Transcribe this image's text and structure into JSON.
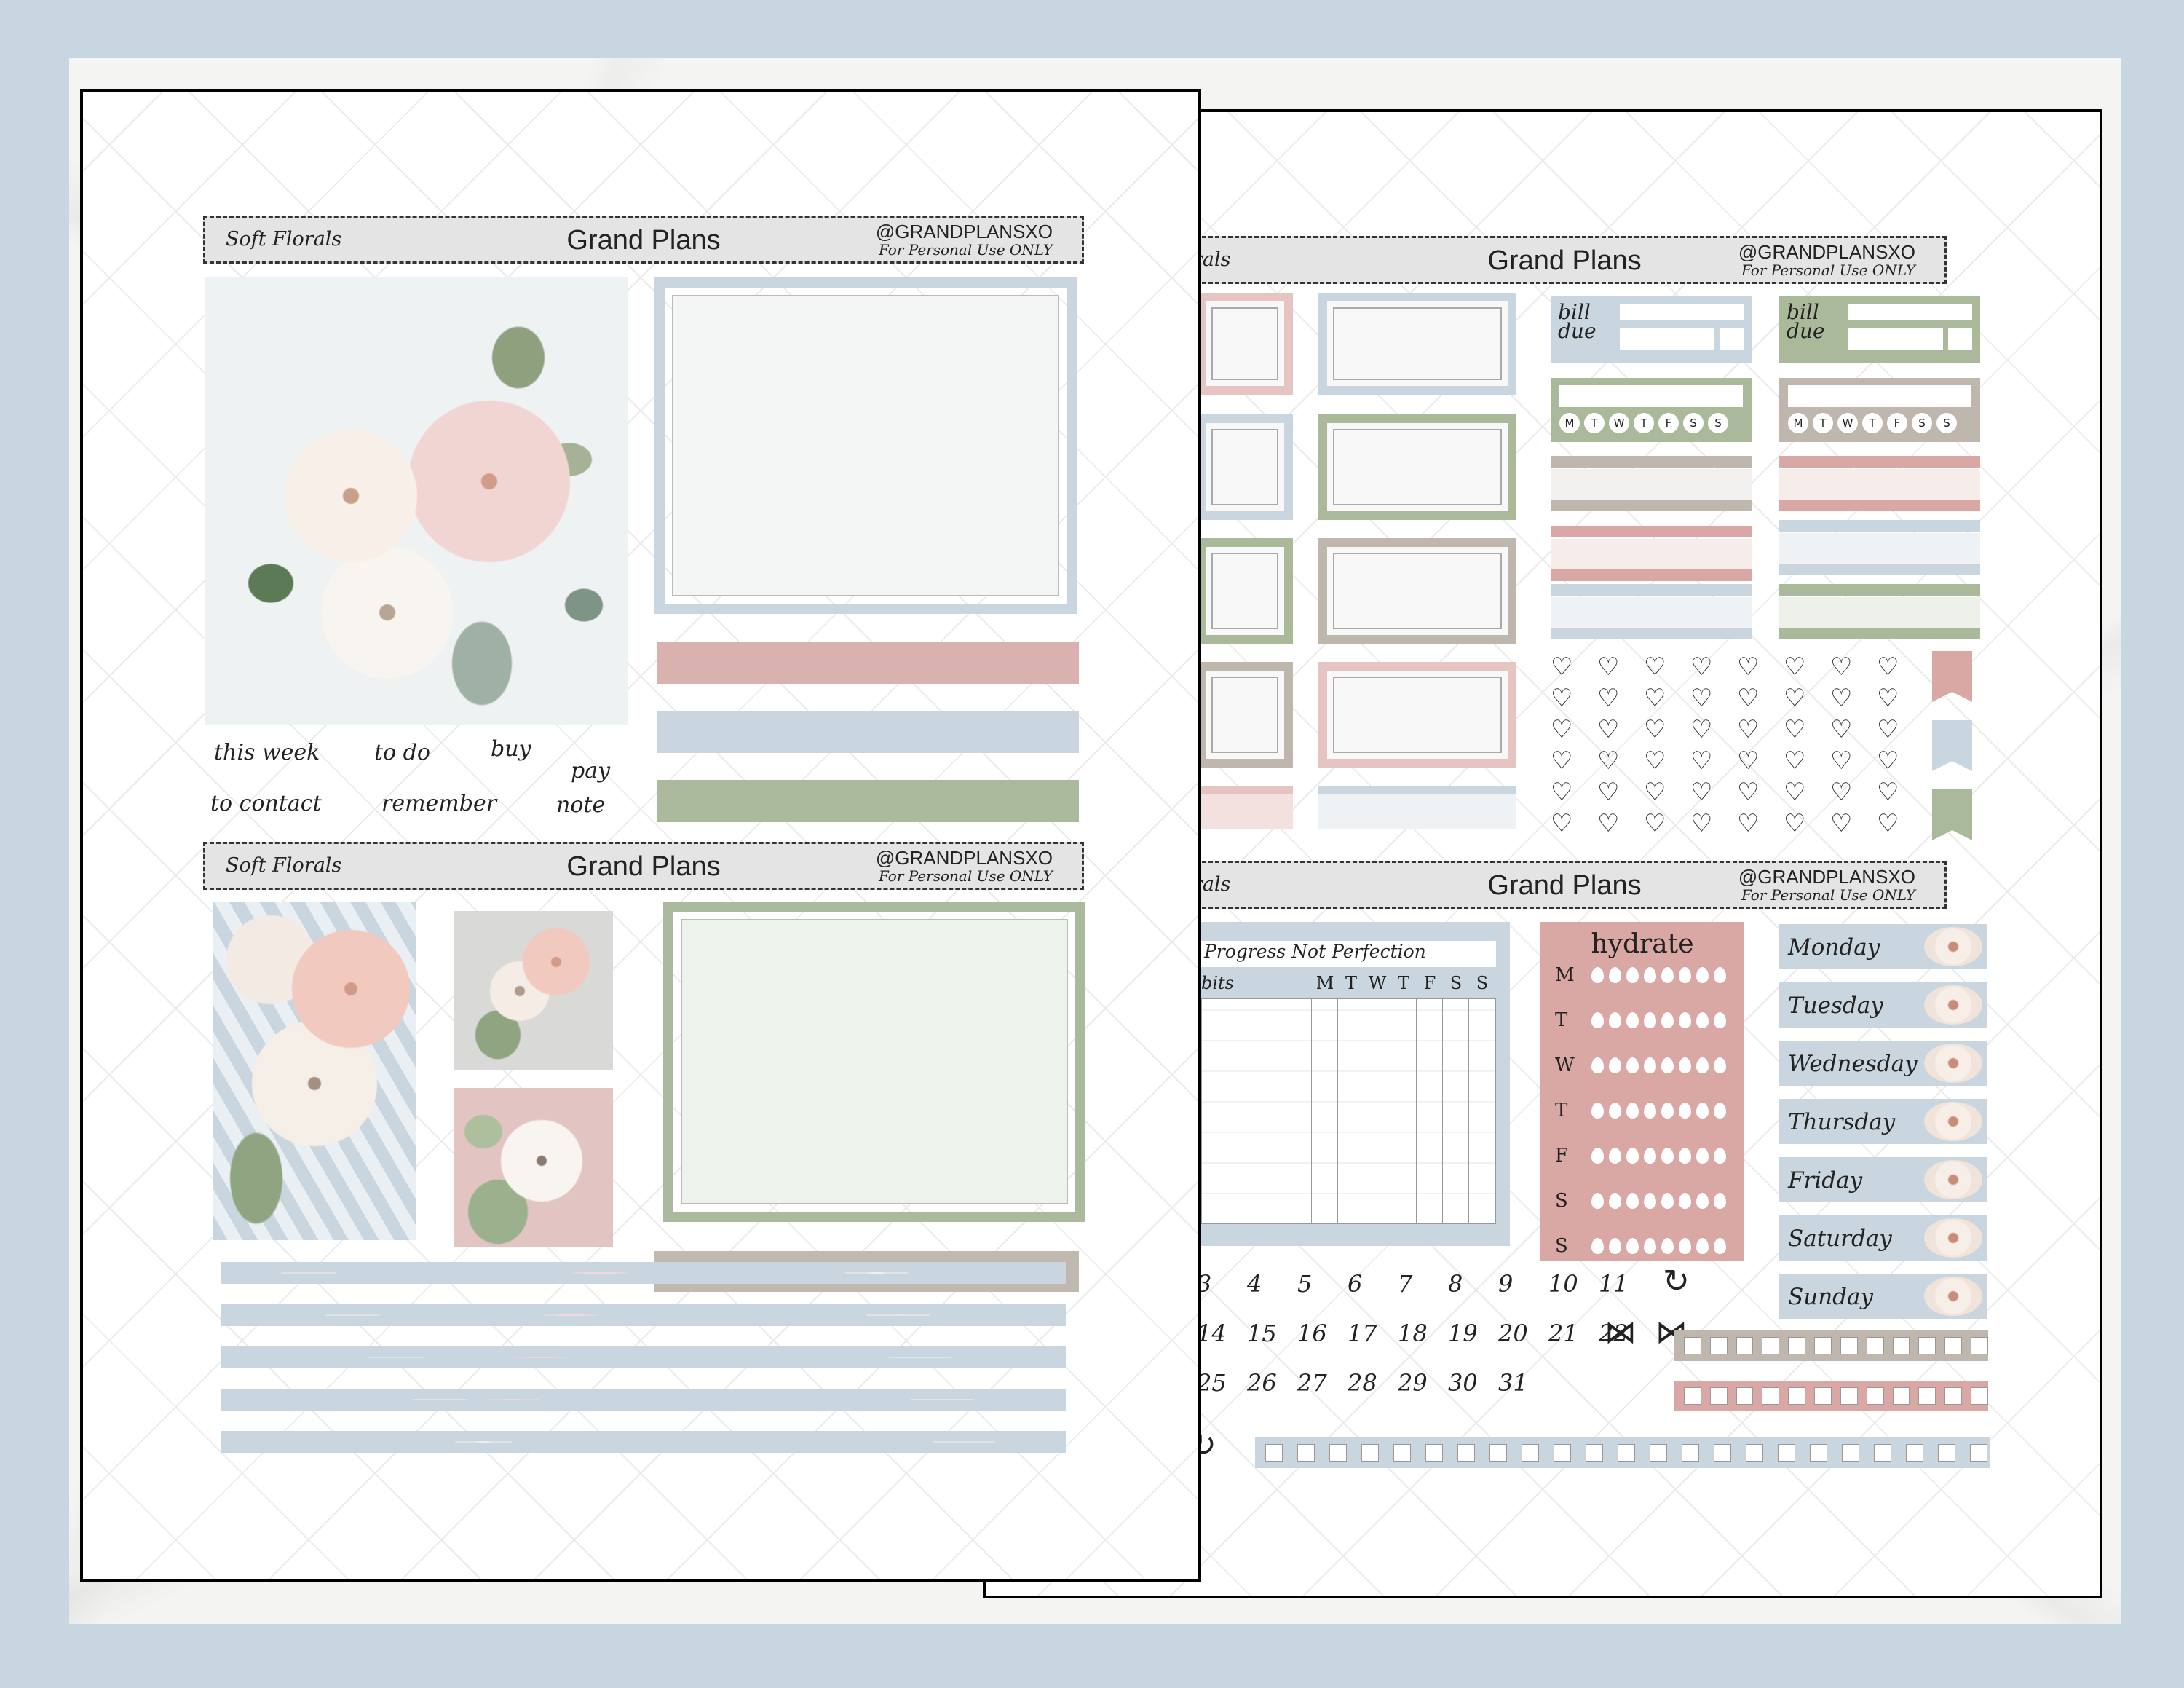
{
  "sheet1": {
    "header1": {
      "left": "Soft Florals",
      "center": "Grand Plans",
      "handle": "@GRANDPLANSXO",
      "note": "For Personal Use ONLY"
    },
    "header2": {
      "left": "Soft Florals",
      "center": "Grand Plans",
      "handle": "@GRANDPLANSXO",
      "note": "For Personal Use ONLY"
    },
    "script_labels": [
      "this week",
      "to do",
      "buy",
      "pay",
      "to contact",
      "remember",
      "note"
    ]
  },
  "sheet2": {
    "header1": {
      "left": "rals",
      "center": "Grand Plans",
      "handle": "@GRANDPLANSXO",
      "note": "For Personal Use ONLY"
    },
    "header2": {
      "left": "rals",
      "center": "Grand Plans",
      "handle": "@GRANDPLANSXO",
      "note": "For Personal Use ONLY"
    },
    "bill_label": "bill due",
    "weekdays_short": [
      "M",
      "T",
      "W",
      "T",
      "F",
      "S",
      "S"
    ],
    "habit": {
      "title": "Progress Not Perfection",
      "col_label": "bits",
      "days": [
        "M",
        "T",
        "W",
        "T",
        "F",
        "S",
        "S"
      ]
    },
    "hydrate": {
      "title": "hydrate",
      "days": [
        "M",
        "T",
        "W",
        "T",
        "F",
        "S",
        "S"
      ]
    },
    "days": [
      "Monday",
      "Tuesday",
      "Wednesday",
      "Thursday",
      "Friday",
      "Saturday",
      "Sunday"
    ],
    "dates_row1": [
      "3",
      "4",
      "5",
      "6",
      "7",
      "8",
      "9",
      "10",
      "11"
    ],
    "dates_row2": [
      "14",
      "15",
      "16",
      "17",
      "18",
      "19",
      "20",
      "21",
      "22"
    ],
    "dates_row3": [
      "25",
      "26",
      "27",
      "28",
      "29",
      "30",
      "31"
    ]
  },
  "colors": {
    "pink": "#d9a8a5",
    "blue": "#c9d6e0",
    "green": "#a9b99a",
    "taupe": "#bfb6ad",
    "background": "#c7d6e0"
  }
}
